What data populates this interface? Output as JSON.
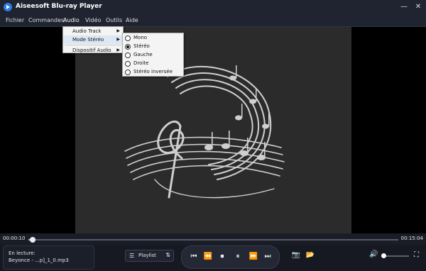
{
  "window": {
    "title": "Aiseesoft Blu-ray Player",
    "minimize_icon": "—",
    "close_icon": "✕"
  },
  "menubar": {
    "items": [
      "Fichier",
      "Commandes",
      "Audio",
      "Vidéo",
      "Outils",
      "Aide"
    ],
    "active": "Audio"
  },
  "audio_menu": {
    "items": [
      {
        "label": "Audio Track",
        "submenu": true
      },
      {
        "label": "Mode Stéréo",
        "submenu": true,
        "highlighted": true
      },
      {
        "label": "Dispositif Audio",
        "submenu": true
      }
    ]
  },
  "stereo_submenu": {
    "options": [
      "Mono",
      "Stéréo",
      "Gauche",
      "Droite",
      "Stéréo inversée"
    ],
    "selected": "Stéréo"
  },
  "player": {
    "time_current": "00:00:10",
    "time_total": "00:15:04",
    "progress_fraction": 0.011,
    "now_playing_label": "En lecture:",
    "now_playing_file": "Beyonce - ...p]_1_0.mp3",
    "playlist_label": "Playlist",
    "volume_fraction": 0.05
  },
  "icons": {
    "app": "play-circle-icon",
    "submenu_arrow": "▶",
    "playlist": "☰",
    "playlist_sort": "⇅",
    "prev": "⏮",
    "rewind": "⏪",
    "stop": "⏹",
    "pause": "⏸",
    "forward": "⏩",
    "next": "⏭",
    "camera": "📷",
    "folder": "📂",
    "volume": "🔊",
    "fullscreen": "⛶"
  },
  "colors": {
    "titlebar": "#1f2430",
    "accent": "#2a7de1",
    "menu_highlight": "#dce7f5"
  }
}
